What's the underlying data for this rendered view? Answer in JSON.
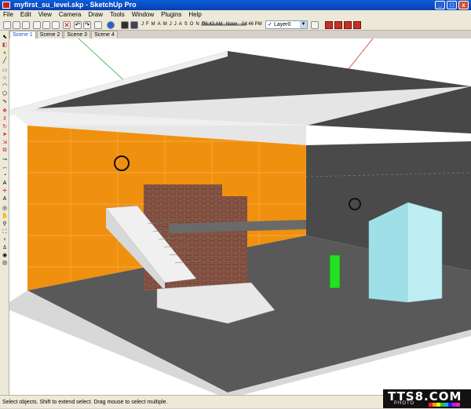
{
  "window": {
    "title": "myfirst_su_level.skp - SketchUp Pro",
    "min": "_",
    "max": "□",
    "close": "x"
  },
  "menu": [
    "File",
    "Edit",
    "View",
    "Camera",
    "Draw",
    "Tools",
    "Window",
    "Plugins",
    "Help"
  ],
  "shadow_toolbar": {
    "months": [
      "J",
      "F",
      "M",
      "A",
      "M",
      "J",
      "J",
      "A",
      "S",
      "O",
      "N",
      "D"
    ],
    "time_start": "06:43 AM",
    "time_mid": "Noon",
    "time_end": "04:46 PM"
  },
  "layer": {
    "checked": "✓",
    "value": "Layer0",
    "arrow": "▼"
  },
  "scenes": [
    "Scene 1",
    "Scene 2",
    "Scene 3",
    "Scene 4"
  ],
  "active_scene": "Scene 1",
  "status_text": "Select objects. Shift to extend select. Drag mouse to select multiple.",
  "watermark": {
    "main": "TTS8.COM",
    "sub": "PHOTO"
  },
  "colors": {
    "title_bar": "#0b4fcf",
    "orange_wall": "#f0900f",
    "dark_wall": "#4a4a4a",
    "floor": "#595959",
    "brick": "#7a4a3c",
    "green_figure": "#22e022",
    "cyan_block": "#bfeef2"
  },
  "icons": {
    "toolbar": [
      "new-icon",
      "open-icon",
      "save-icon",
      "cut-icon",
      "copy-icon",
      "paste-icon",
      "erase-icon",
      "undo-icon",
      "redo-icon",
      "print-icon",
      "model-info-icon"
    ],
    "left": [
      "select-icon",
      "eraser-icon",
      "paint-icon",
      "line-icon",
      "rectangle-icon",
      "circle-icon",
      "arc-icon",
      "polygon-icon",
      "freehand-icon",
      "move-icon",
      "push-pull-icon",
      "rotate-icon",
      "follow-me-icon",
      "scale-icon",
      "offset-icon",
      "tape-icon",
      "dimension-icon",
      "protractor-icon",
      "text-icon",
      "axes-icon",
      "3d-text-icon",
      "orbit-icon",
      "pan-icon",
      "zoom-icon",
      "zoom-extents-icon",
      "position-camera-icon",
      "walk-icon",
      "look-around-icon",
      "section-plane-icon"
    ]
  }
}
